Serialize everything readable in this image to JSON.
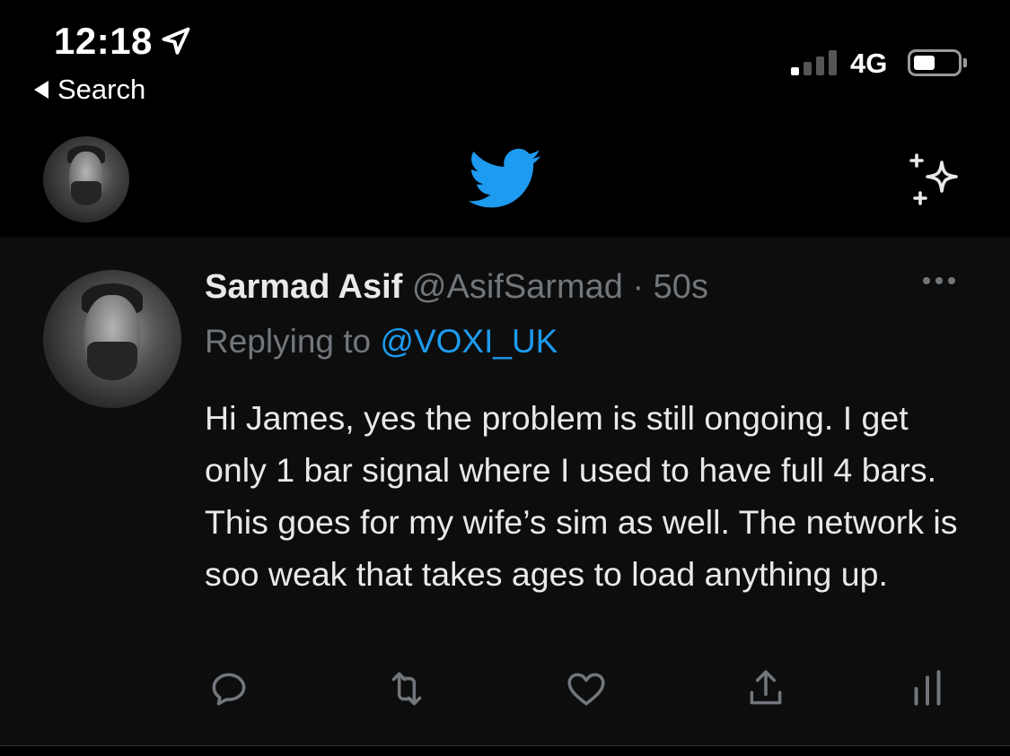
{
  "status_bar": {
    "time": "12:18",
    "back_label": "Search",
    "network": "4G",
    "signal_bars_on": 1,
    "signal_bars_total": 4,
    "battery_level": 0.35
  },
  "header": {
    "logo_icon": "twitter-bird-icon",
    "sparkle_icon": "sparkle-icon"
  },
  "tweet": {
    "display_name": "Sarmad Asif",
    "handle": "@AsifSarmad",
    "separator": "·",
    "time_ago": "50s",
    "replying_prefix": "Replying to",
    "replying_to": "@VOXI_UK",
    "text": "Hi James, yes the problem is still ongoing. I get only 1 bar signal where I used to have full 4 bars. This goes for my wife’s sim as well. The network is soo weak that takes ages to load anything up.",
    "actions": [
      "reply-icon",
      "retweet-icon",
      "like-icon",
      "share-icon",
      "analytics-icon"
    ]
  },
  "colors": {
    "background": "#000000",
    "tweet_background": "#0d0d0d",
    "text": "#e7e9ea",
    "secondary": "#71767b",
    "accent": "#1d9bf0"
  }
}
